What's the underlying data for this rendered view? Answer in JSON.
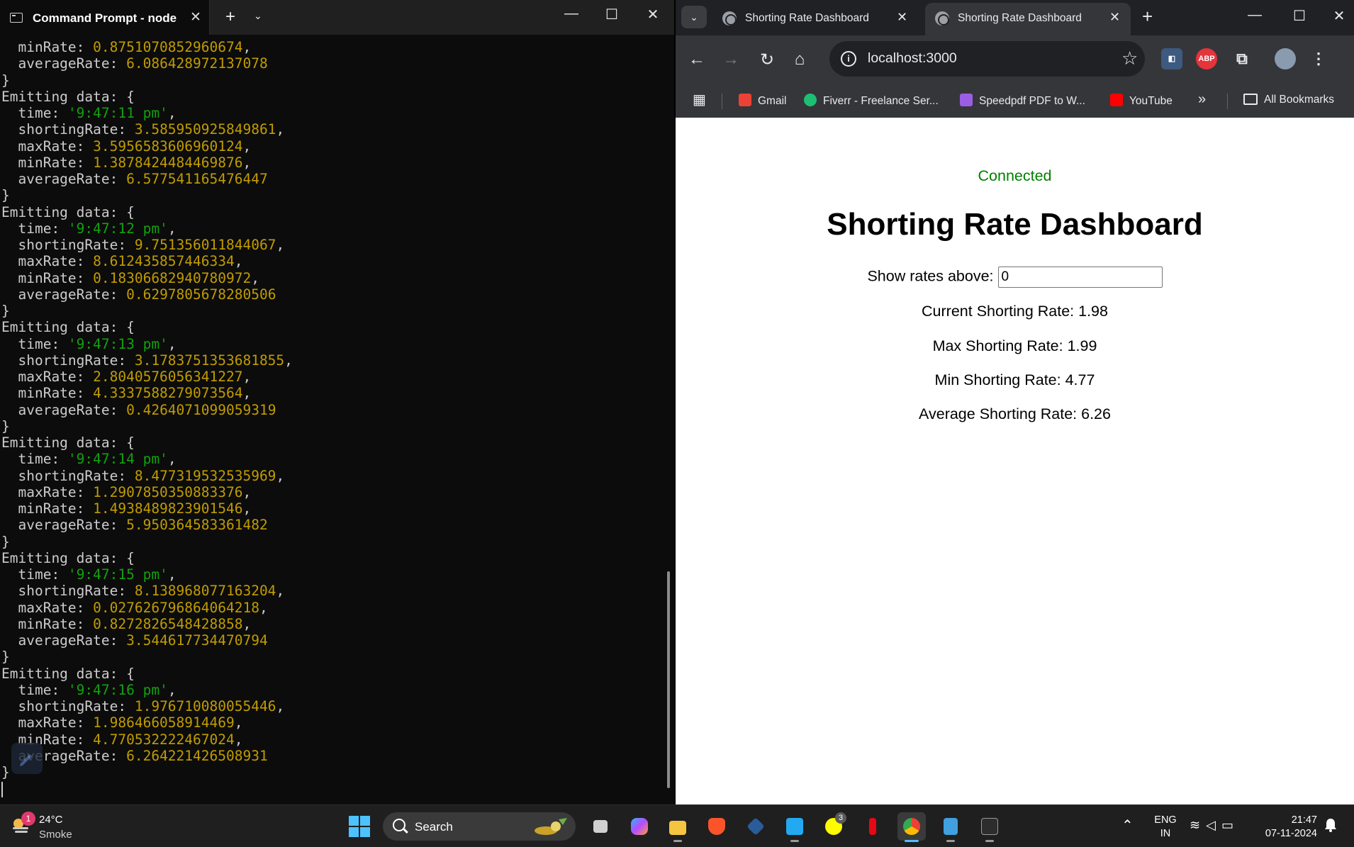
{
  "terminal": {
    "tab_title": "Command Prompt - node",
    "first_lines": [
      {
        "key": "minRate",
        "value": "0.8751070852960674"
      },
      {
        "key": "averageRate",
        "value": "6.086428972137078"
      }
    ],
    "emit_label": "Emitting data: {",
    "events": [
      {
        "time": "'9:47:11 pm'",
        "shortingRate": "3.585950925849861",
        "maxRate": "3.5956583606960124",
        "minRate": "1.3878424484469876",
        "averageRate": "6.5775411654764 47"
      },
      {
        "time": "'9:47:12 pm'",
        "shortingRate": "9.751356011844067",
        "maxRate": "8.612435857446334",
        "minRate": "0.18306682940780972",
        "averageRate": "0.6297805678280506"
      },
      {
        "time": "'9:47:13 pm'",
        "shortingRate": "3.1783751353681855",
        "maxRate": "2.8040576056341227",
        "minRate": "4.3337588279073564",
        "averageRate": "0.4264071099059319"
      },
      {
        "time": "'9:47:14 pm'",
        "shortingRate": "8.477319532535969",
        "maxRate": "1.2907850350883376",
        "minRate": "1.4938489823901546",
        "averageRate": "5.950364583361482"
      },
      {
        "time": "'9:47:15 pm'",
        "shortingRate": "8.138968077163204",
        "maxRate": "0.027626796864064218",
        "minRate": "0.8272826548428858",
        "averageRate": "3.544617734470794"
      },
      {
        "time": "'9:47:16 pm'",
        "shortingRate": "1.976710080055446",
        "maxRate": "1.986466058914469",
        "minRate": "4.770532222467024",
        "averageRate": "6.264221426508931"
      }
    ]
  },
  "browser": {
    "tabs": [
      {
        "title": "Shorting Rate Dashboard",
        "active": false
      },
      {
        "title": "Shorting Rate Dashboard",
        "active": true
      }
    ],
    "url": "localhost:3000",
    "bookmarks": [
      "Gmail",
      "Fiverr - Freelance Ser...",
      "Speedpdf PDF to W...",
      "YouTube"
    ],
    "all_bookmarks": "All Bookmarks",
    "extension_abp": "ABP"
  },
  "dashboard": {
    "status": "Connected",
    "title": "Shorting Rate Dashboard",
    "filter_label": "Show rates above:",
    "filter_value": "0",
    "current": "Current Shorting Rate: 1.98",
    "max": "Max Shorting Rate: 1.99",
    "min": "Min Shorting Rate: 4.77",
    "average": "Average Shorting Rate: 6.26"
  },
  "taskbar": {
    "weather_badge": "1",
    "temperature": "24°C",
    "condition": "Smoke",
    "search_label": "Search",
    "snapchat_badge": "3",
    "lang_1": "ENG",
    "lang_2": "IN",
    "time": "21:47",
    "date": "07-11-2024"
  },
  "colors": {
    "terminal_bg": "#0c0c0c",
    "number": "#c19c00",
    "string": "#13a10e",
    "connected": "#008000",
    "accent": "#4cc2ff"
  }
}
